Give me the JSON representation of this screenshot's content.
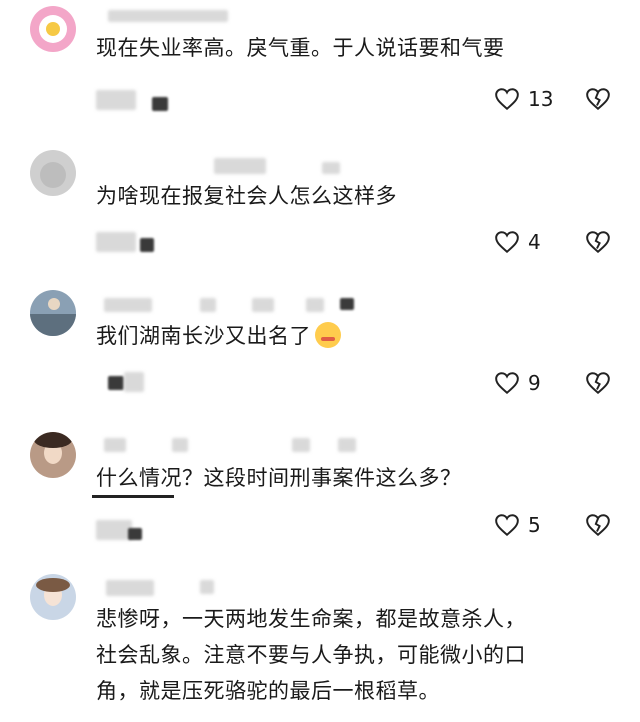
{
  "comments": [
    {
      "text_lines": [
        "现在失业率高。戾气重。于人说话要和气要"
      ],
      "likes": "13"
    },
    {
      "text_lines": [
        "为啥现在报复社会人怎么这样多"
      ],
      "likes": "4"
    },
    {
      "text_lines": [
        "我们湖南长沙又出名了"
      ],
      "likes": "9",
      "emoji": "kiss-face"
    },
    {
      "text_lines": [
        "什么情况？这段时间刑事案件这么多？"
      ],
      "likes": "5"
    },
    {
      "text_lines": [
        "悲惨呀，一天两地发生命案，都是故意杀人，",
        "社会乱象。注意不要与人争执，可能微小的口",
        "角，就是压死骆驼的最后一根稻草。"
      ]
    }
  ],
  "icons": {
    "like": "heart-outline-icon",
    "dislike": "broken-heart-icon"
  },
  "colors": {
    "text": "#1a1a1a",
    "placeholder_blur": "#d9d9d9",
    "emoji": "#ffcc4d"
  }
}
